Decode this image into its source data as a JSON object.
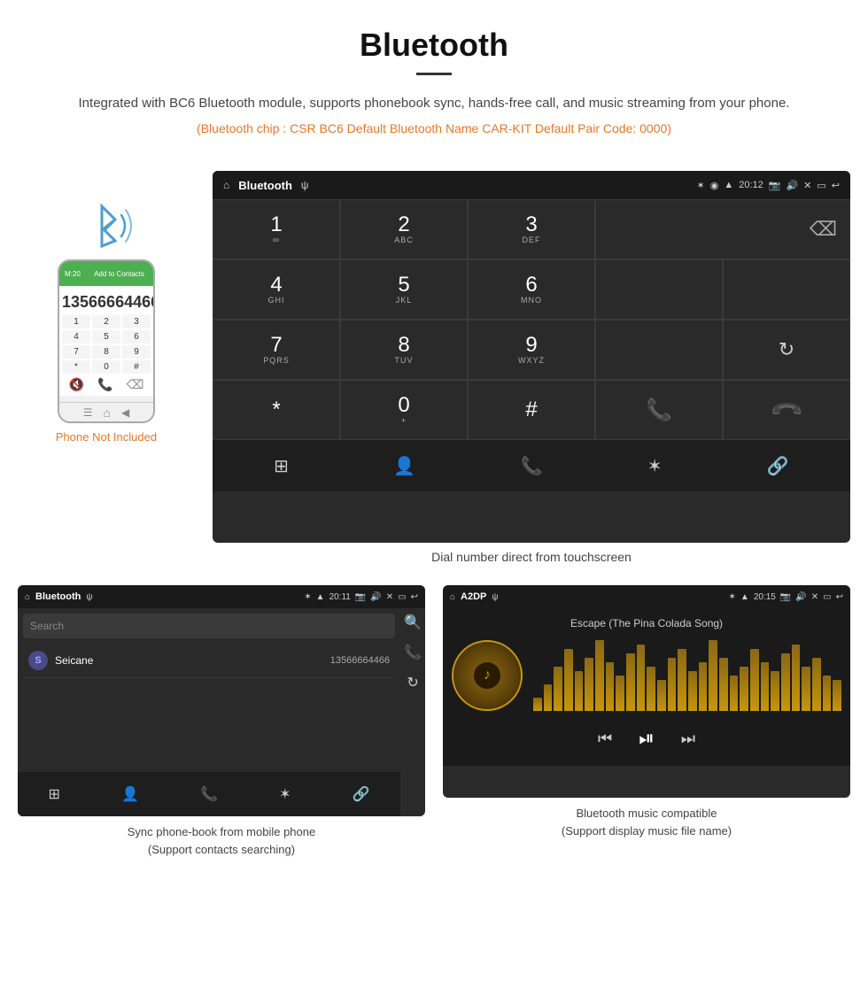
{
  "page": {
    "title": "Bluetooth",
    "description": "Integrated with BC6 Bluetooth module, supports phonebook sync, hands-free call, and music streaming from your phone.",
    "specs": "(Bluetooth chip : CSR BC6    Default Bluetooth Name CAR-KIT    Default Pair Code: 0000)"
  },
  "phone_notice": "Phone Not Included",
  "dial_screen": {
    "status_left": "🏠  Bluetooth  ψ",
    "status_center": "Bluetooth",
    "status_time": "20:12",
    "keys": [
      {
        "number": "1",
        "letters": "∞"
      },
      {
        "number": "2",
        "letters": "ABC"
      },
      {
        "number": "3",
        "letters": "DEF"
      },
      {
        "number": "4",
        "letters": "GHI"
      },
      {
        "number": "5",
        "letters": "JKL"
      },
      {
        "number": "6",
        "letters": "MNO"
      },
      {
        "number": "7",
        "letters": "PQRS"
      },
      {
        "number": "8",
        "letters": "TUV"
      },
      {
        "number": "9",
        "letters": "WXYZ"
      },
      {
        "number": "*",
        "letters": ""
      },
      {
        "number": "0",
        "letters": "+"
      },
      {
        "number": "#",
        "letters": ""
      }
    ],
    "caption": "Dial number direct from touchscreen"
  },
  "phonebook_screen": {
    "title": "Bluetooth",
    "time": "20:11",
    "search_placeholder": "Search",
    "contact_name": "Seicane",
    "contact_number": "13566664466",
    "caption_line1": "Sync phone-book from mobile phone",
    "caption_line2": "(Support contacts searching)"
  },
  "a2dp_screen": {
    "title": "A2DP",
    "time": "20:15",
    "song_title": "Escape (The Pina Colada Song)",
    "caption_line1": "Bluetooth music compatible",
    "caption_line2": "(Support display music file name)"
  },
  "viz_bars": [
    15,
    30,
    50,
    70,
    45,
    60,
    80,
    55,
    40,
    65,
    75,
    50,
    35,
    60,
    70,
    45,
    55,
    80,
    60,
    40,
    50,
    70,
    55,
    45,
    65,
    75,
    50,
    60,
    40,
    35
  ]
}
